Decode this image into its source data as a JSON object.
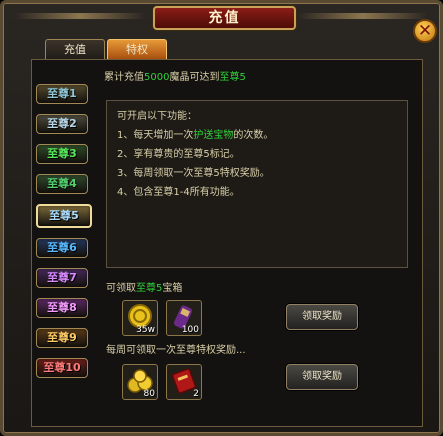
{
  "window": {
    "title": "充值"
  },
  "tabs": [
    {
      "label": "充值",
      "active": false
    },
    {
      "label": "特权",
      "active": true
    }
  ],
  "ranks": [
    {
      "label": "至尊1",
      "color": "#8fc7d6",
      "bg": "#554a2d"
    },
    {
      "label": "至尊2",
      "color": "#b7d7e8",
      "bg": "#4d4b3d"
    },
    {
      "label": "至尊3",
      "color": "#58e85c",
      "bg": "#2e4b28"
    },
    {
      "label": "至尊4",
      "color": "#54d16f",
      "bg": "#2f4a2c"
    },
    {
      "label": "至尊5",
      "color": "#a9dcff",
      "bg": "#7c6a3a",
      "selected": true
    },
    {
      "label": "至尊6",
      "color": "#59b9ff",
      "bg": "#23365a"
    },
    {
      "label": "至尊7",
      "color": "#d88cff",
      "bg": "#45285a"
    },
    {
      "label": "至尊8",
      "color": "#f59aff",
      "bg": "#5a2864"
    },
    {
      "label": "至尊9",
      "color": "#ffcc66",
      "bg": "#5a3a16"
    },
    {
      "label": "至尊10",
      "color": "#ff7a7a",
      "bg": "#6a1e1a"
    }
  ],
  "summary": {
    "prefix": "累计充值",
    "amount": "5000",
    "middle": "魔晶可达到",
    "rank": "至尊5"
  },
  "features": {
    "heading": "可开启以下功能：",
    "line1_prefix": "1、每天增加一次",
    "line1_highlight": "护送宝物",
    "line1_suffix": "的次数。",
    "line2": "2、享有尊贵的至尊5标记。",
    "line3": "3、每周领取一次至尊5特权奖励。",
    "line4": "4、包含至尊1-4所有功能。"
  },
  "reward_box": {
    "prefix": "可领取",
    "rank": "至尊5",
    "suffix": "宝箱",
    "items": [
      {
        "icon": "gold-coin-icon",
        "count": "35w"
      },
      {
        "icon": "scroll-icon",
        "count": "100"
      }
    ],
    "claim_label": "领取奖励"
  },
  "reward_weekly": {
    "title": "每周可领取一次至尊特权奖励...",
    "items": [
      {
        "icon": "gold-pile-icon",
        "count": "80"
      },
      {
        "icon": "red-token-icon",
        "count": "2"
      }
    ],
    "claim_label": "领取奖励"
  },
  "colors": {
    "accent": "#30d03a",
    "title_red": "#8a1d16",
    "tab_active": "#e79a37"
  }
}
